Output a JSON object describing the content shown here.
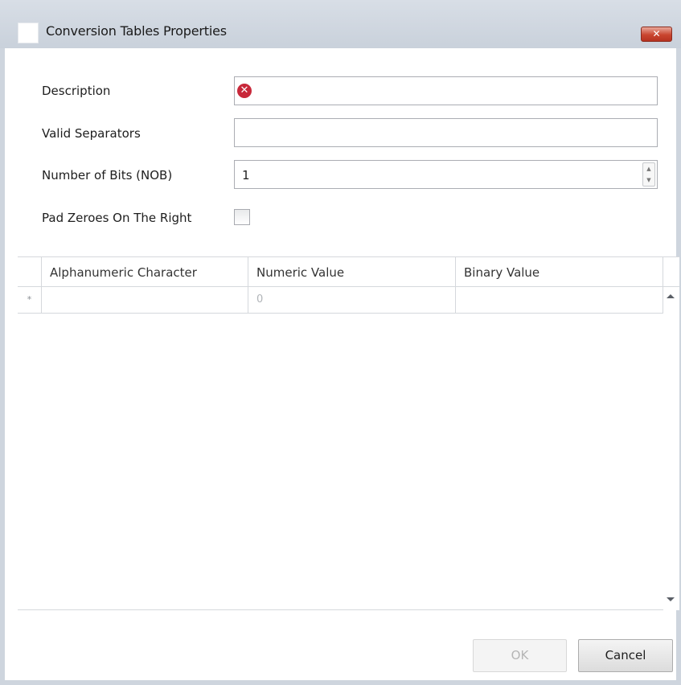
{
  "window": {
    "title": "Conversion Tables Properties",
    "close_glyph": "✕"
  },
  "form": {
    "description_label": "Description",
    "description_value": "",
    "description_error_glyph": "✕",
    "separators_label": "Valid Separators",
    "separators_value": "",
    "nob_label": "Number of Bits (NOB)",
    "nob_value": "1",
    "pad_label": "Pad Zeroes On The Right",
    "pad_checked": false
  },
  "grid": {
    "columns": [
      "Alphanumeric Character",
      "Numeric Value",
      "Binary Value"
    ],
    "new_row": {
      "marker": "*",
      "cells": [
        "",
        "0",
        ""
      ]
    }
  },
  "buttons": {
    "ok": "OK",
    "cancel": "Cancel"
  },
  "icons": {
    "app": "app-icon",
    "close": "close-icon",
    "error": "error-icon",
    "spin_up": "chevron-up-icon",
    "spin_down": "chevron-down-icon",
    "scroll_up": "scroll-up-arrow-icon",
    "scroll_down": "scroll-down-arrow-icon"
  },
  "colors": {
    "error": "#c8283a",
    "close_button": "#c9452f",
    "title_bar": "#d8dee6"
  }
}
